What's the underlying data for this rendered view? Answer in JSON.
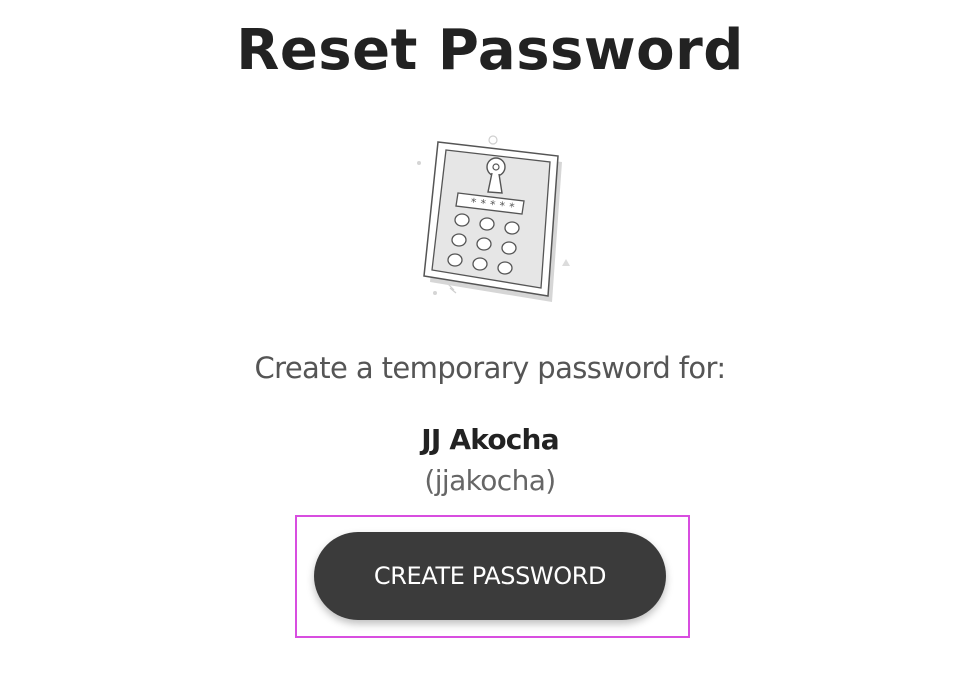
{
  "header": {
    "title": "Reset Password"
  },
  "illustration": {
    "icon": "keypad-lock-icon",
    "masked_password": "*****"
  },
  "main": {
    "prompt": "Create a temporary password for:",
    "user": {
      "name": "JJ Akocha",
      "login": "(jjakocha)"
    },
    "create_button_label": "CREATE PASSWORD"
  },
  "colors": {
    "button_bg": "#3b3b3b",
    "button_text": "#ffffff",
    "highlight": "#d84ee0",
    "title_text": "#222222"
  }
}
